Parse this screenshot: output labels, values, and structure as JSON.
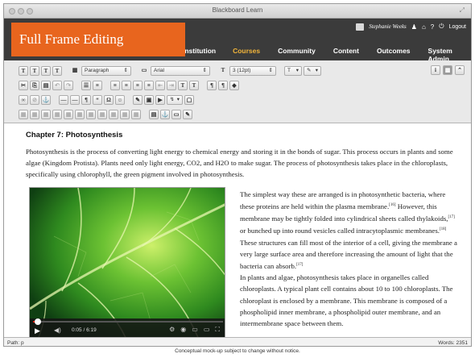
{
  "window": {
    "title": "Blackboard Learn"
  },
  "banner": {
    "label": "Full Frame Editing"
  },
  "user": {
    "name": "Stephanie Weeks",
    "logout": "Logout"
  },
  "nav": {
    "links": [
      "Institution",
      "Courses",
      "Community",
      "Content",
      "Outcomes",
      "System Admin"
    ],
    "active": "Courses"
  },
  "toolbar": {
    "paragraph_select": "Paragraph",
    "font_select": "Arial",
    "size_select": "3 (12pt)",
    "row1_buttons": [
      "T",
      "T",
      "T",
      "T"
    ],
    "format_buttons": [
      "T",
      "T"
    ]
  },
  "document": {
    "heading": "Chapter 7: Photosynthesis",
    "intro": "Photosynthesis is the process of converting light energy to chemical energy and storing it in the bonds of sugar. This process occurs in plants and some algae (Kingdom Protista). Plants need only light energy, CO2, and H2O to make sugar. The process of photosynthesis takes place in the chloroplasts, specifically using chlorophyll, the green pigment involved in photosynthesis.",
    "para1_a": "The simplest way these are arranged is in photosynthetic bacteria, where these proteins are held within the plasma membrane.",
    "ref1": "[16]",
    "para1_b": " However, this membrane may be tightly folded into cylindrical sheets called thylakoids,",
    "ref2": "[17]",
    "para1_c": " or bunched up into round vesicles called intracytoplasmic membranes.",
    "ref3": "[18]",
    "para1_d": " These structures can fill most of the interior of a cell, giving the membrane a very large surface area and therefore increasing the amount of light that the bacteria can absorb.",
    "ref4": "[17]",
    "para2": "In plants and algae, photosynthesis takes place in organelles called chloroplasts. A typical plant cell contains about 10 to 100 chloroplasts. The chloroplast is enclosed by a membrane. This membrane is composed of a phospholipid inner membrane, a phospholipid outer membrane, and an intermembrane space between them."
  },
  "video": {
    "time": "0:05 / 6:19",
    "progress": 0.013
  },
  "status": {
    "path": "Path: p",
    "words": "Words: 2351"
  },
  "footer": {
    "note": "Conceptual mock-up subject to change without notice."
  },
  "colors": {
    "banner": "#e8651e",
    "nav_bg": "#3b3b3b",
    "nav_active": "#f2b53a"
  }
}
